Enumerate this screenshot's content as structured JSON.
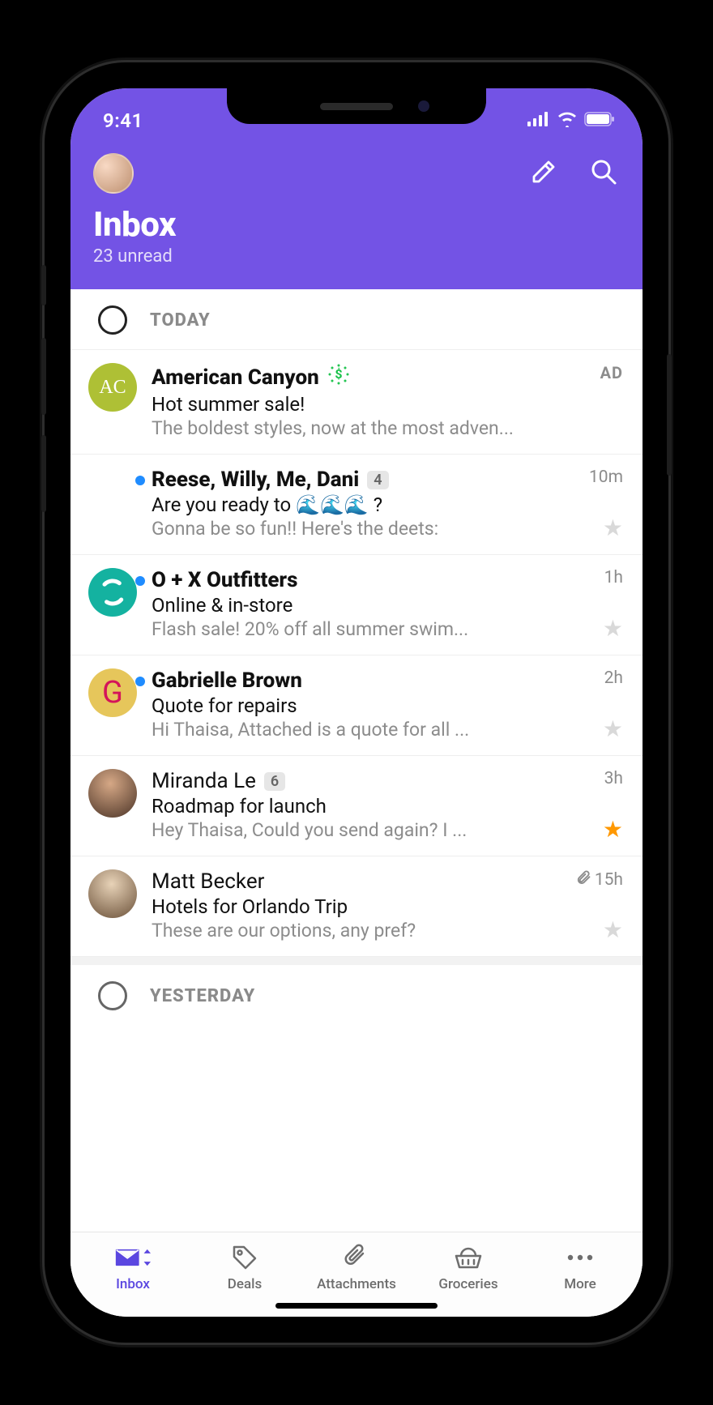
{
  "status": {
    "time": "9:41"
  },
  "header": {
    "title": "Inbox",
    "subtitle": "23 unread"
  },
  "sections": {
    "today": "TODAY",
    "yesterday": "YESTERDAY"
  },
  "messages": [
    {
      "sender": "American Canyon",
      "subject": "Hot summer sale!",
      "preview": "The boldest styles, now at the most adven...",
      "ad_label": "AD",
      "avatar_text": "AC",
      "avatar_bg": "#aec035",
      "is_ad": true,
      "unread": false,
      "has_dollar": true
    },
    {
      "sender": "Reese, Willy, Me, Dani",
      "count": "4",
      "subject": "Are you ready to  🌊🌊🌊 ?",
      "preview": "Gonna be so fun!! Here's the deets:",
      "time": "10m",
      "unread": true,
      "starred": false,
      "avatar_grid": true
    },
    {
      "sender": "O + X Outfitters",
      "subject": "Online & in-store",
      "preview": "Flash sale! 20% off all summer swim...",
      "time": "1h",
      "unread": true,
      "starred": false,
      "avatar_bg": "#14b2a0",
      "avatar_swirl": true
    },
    {
      "sender": "Gabrielle Brown",
      "subject": "Quote for repairs",
      "preview": "Hi Thaisa, Attached is a quote for all ...",
      "time": "2h",
      "unread": true,
      "starred": false,
      "avatar_text": "G",
      "avatar_bg": "#e6c65b",
      "avatar_fg": "#d4145a"
    },
    {
      "sender": "Miranda Le",
      "count": "6",
      "subject": "Roadmap for launch",
      "preview": "Hey Thaisa, Could you send again? I ...",
      "time": "3h",
      "unread": false,
      "starred": true,
      "avatar_bg": "#7a5548",
      "avatar_photo": true
    },
    {
      "sender": "Matt Becker",
      "subject": "Hotels for Orlando Trip",
      "preview": "These are our options, any pref?",
      "time": "15h",
      "unread": false,
      "starred": false,
      "has_attachment": true,
      "avatar_bg": "#9b7b5c",
      "avatar_photo": true
    }
  ],
  "tabs": [
    {
      "label": "Inbox",
      "active": true
    },
    {
      "label": "Deals",
      "active": false
    },
    {
      "label": "Attachments",
      "active": false
    },
    {
      "label": "Groceries",
      "active": false
    },
    {
      "label": "More",
      "active": false
    }
  ]
}
